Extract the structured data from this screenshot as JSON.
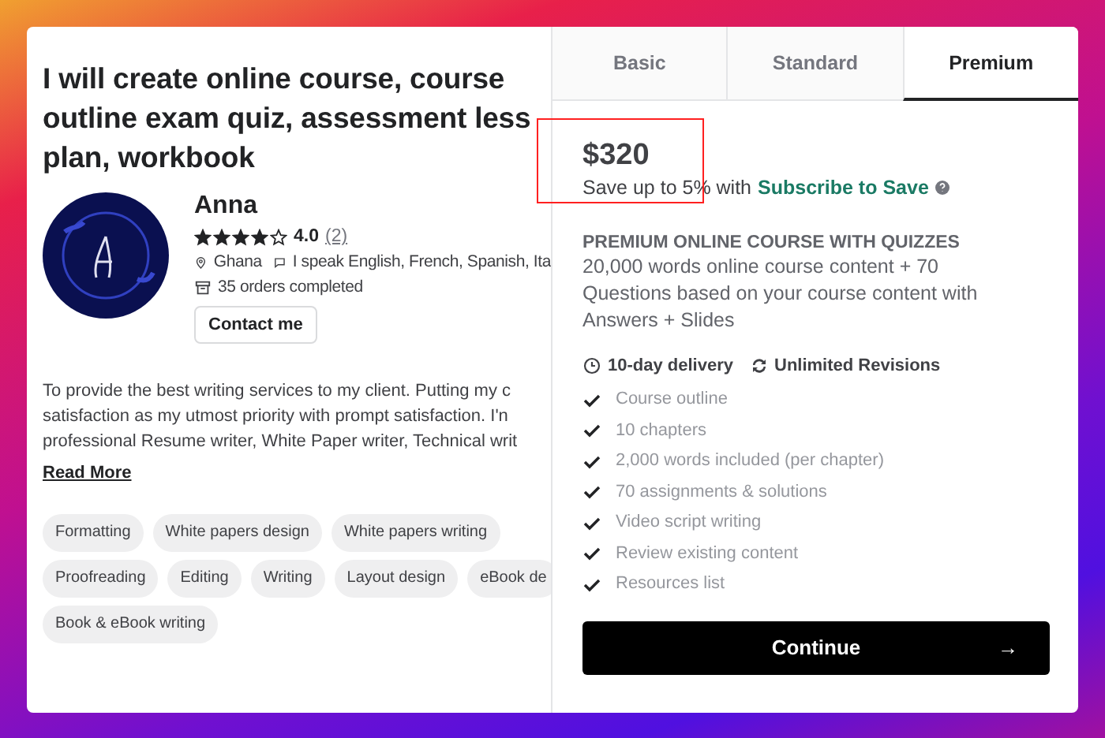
{
  "gig": {
    "title_lines": [
      "I will create online course, course",
      "outline exam quiz, assessment less",
      "plan, workbook"
    ]
  },
  "seller": {
    "name": "Anna",
    "stars": 4,
    "rating": "4.0",
    "reviews": "(2)",
    "country": "Ghana",
    "languages": "I speak English, French, Spanish, Ita",
    "orders": "35 orders completed",
    "contact_button": "Contact me"
  },
  "description": {
    "lines": [
      "To provide the best writing services to my client. Putting my c",
      "satisfaction as my utmost priority with prompt satisfaction. I'n",
      "professional Resume writer, White Paper writer, Technical writ"
    ],
    "read_more": "Read More"
  },
  "tags": [
    [
      "Formatting",
      "White papers design",
      "White papers writing"
    ],
    [
      "Proofreading",
      "Editing",
      "Writing",
      "Layout design",
      "eBook de"
    ],
    [
      "Book & eBook writing"
    ]
  ],
  "tabs": [
    {
      "label": "Basic",
      "selected": false
    },
    {
      "label": "Standard",
      "selected": false
    },
    {
      "label": "Premium",
      "selected": true
    }
  ],
  "package": {
    "price": "$320",
    "save_prefix": "Save up to 5% with",
    "save_link": "Subscribe to Save",
    "heading": "PREMIUM ONLINE COURSE WITH QUIZZES",
    "description": "20,000 words online course content + 70 Questions based on your course content with Answers + Slides",
    "delivery": "10-day delivery",
    "revisions": "Unlimited Revisions",
    "features": [
      "Course outline",
      "10 chapters",
      "2,000 words included (per chapter)",
      "70 assignments & solutions",
      "Video script writing",
      "Review existing content",
      "Resources list"
    ],
    "continue_button": "Continue",
    "continue_arrow": "→"
  }
}
